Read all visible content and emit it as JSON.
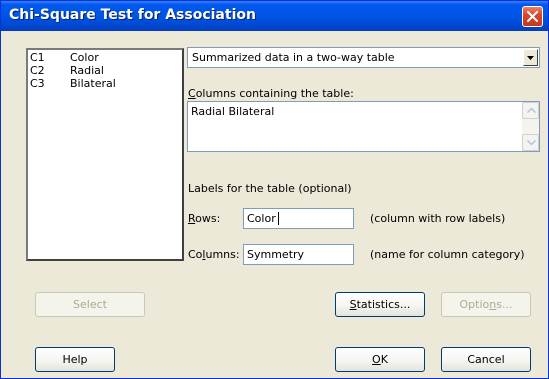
{
  "window": {
    "title": "Chi-Square Test for Association"
  },
  "variables": [
    {
      "column": "C1",
      "name": "Color"
    },
    {
      "column": "C2",
      "name": "Radial"
    },
    {
      "column": "C3",
      "name": "Bilateral"
    }
  ],
  "data_type": {
    "selected": "Summarized data in a two-way table"
  },
  "columns_table": {
    "label_first": "C",
    "label_rest": "olumns containing the table:",
    "value": "Radial Bilateral"
  },
  "labels_section": {
    "heading": "Labels for the table (optional)"
  },
  "rows": {
    "label_first": "R",
    "label_rest": "ows:",
    "value": "Color",
    "hint": "(column with row labels)"
  },
  "columns": {
    "label_pre": "Co",
    "label_key": "l",
    "label_post": "umns:",
    "value": "Symmetry",
    "hint": "(name for column category)"
  },
  "buttons": {
    "select": "Select",
    "statistics_key": "S",
    "statistics_rest": "tatistics...",
    "options_pre": "Optio",
    "options_key": "n",
    "options_post": "s...",
    "help": "Help",
    "ok_key": "O",
    "ok_rest": "K",
    "cancel": "Cancel"
  },
  "colors": {
    "title_bar": "#0055e5",
    "dialog_bg": "#ece9d8",
    "close_button": "#d9472b"
  },
  "icons": {
    "close": "close-icon",
    "dropdown": "chevron-down-icon",
    "scroll_up": "scroll-up-arrow-icon",
    "scroll_down": "scroll-down-arrow-icon"
  }
}
